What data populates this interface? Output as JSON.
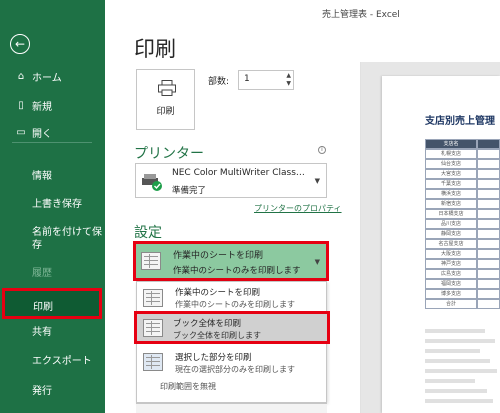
{
  "window": {
    "title": "売上管理表  -  Excel"
  },
  "sidebar": {
    "back_icon": "back-arrow-icon",
    "items": [
      {
        "label": "ホーム",
        "icon": "home-icon"
      },
      {
        "label": "新規",
        "icon": "new-document-icon"
      },
      {
        "label": "開く",
        "icon": "open-folder-icon"
      }
    ],
    "plain_items": [
      {
        "label": "情報",
        "dim": false
      },
      {
        "label": "上書き保存",
        "dim": false
      },
      {
        "label": "名前を付けて保",
        "dim": false
      },
      {
        "label": "存",
        "dim": false
      },
      {
        "label": "履歴",
        "dim": true
      },
      {
        "label": "共有",
        "dim": false
      },
      {
        "label": "エクスポート",
        "dim": false
      },
      {
        "label": "発行",
        "dim": false
      }
    ],
    "selected": "印刷"
  },
  "main": {
    "heading": "印刷",
    "print_button_label": "印刷",
    "copies": {
      "label": "部数:",
      "value": "1"
    },
    "printer_section": {
      "header": "プリンター",
      "name": "NEC Color MultiWriter Class…",
      "status": "準備完了",
      "properties_link": "プリンターのプロパティ"
    },
    "settings_section": {
      "header": "設定",
      "selected": {
        "title": "作業中のシートを印刷",
        "subtitle": "作業中のシートのみを印刷します"
      },
      "options": [
        {
          "title": "作業中のシートを印刷",
          "subtitle": "作業中のシートのみを印刷します"
        },
        {
          "title": "ブック全体を印刷",
          "subtitle": "ブック全体を印刷します"
        },
        {
          "title": "選択した部分を印刷",
          "subtitle": "現在の選択部分のみを印刷します"
        }
      ],
      "ignore_print_area": "印刷範囲を無視"
    }
  },
  "preview": {
    "title": "支店別売上管理",
    "table_header": "支店名",
    "branches": [
      "札幌支店",
      "仙台支店",
      "大宮支店",
      "千葉支店",
      "横浜支店",
      "新宿支店",
      "日本橋支店",
      "品川支店",
      "静岡支店",
      "名古屋支店",
      "大阪支店",
      "神戸支店",
      "広島支店",
      "福岡支店",
      "博多支店",
      "合計"
    ]
  },
  "colors": {
    "sidebar": "#1e7145",
    "accent": "#217346",
    "highlight": "#e60012"
  }
}
